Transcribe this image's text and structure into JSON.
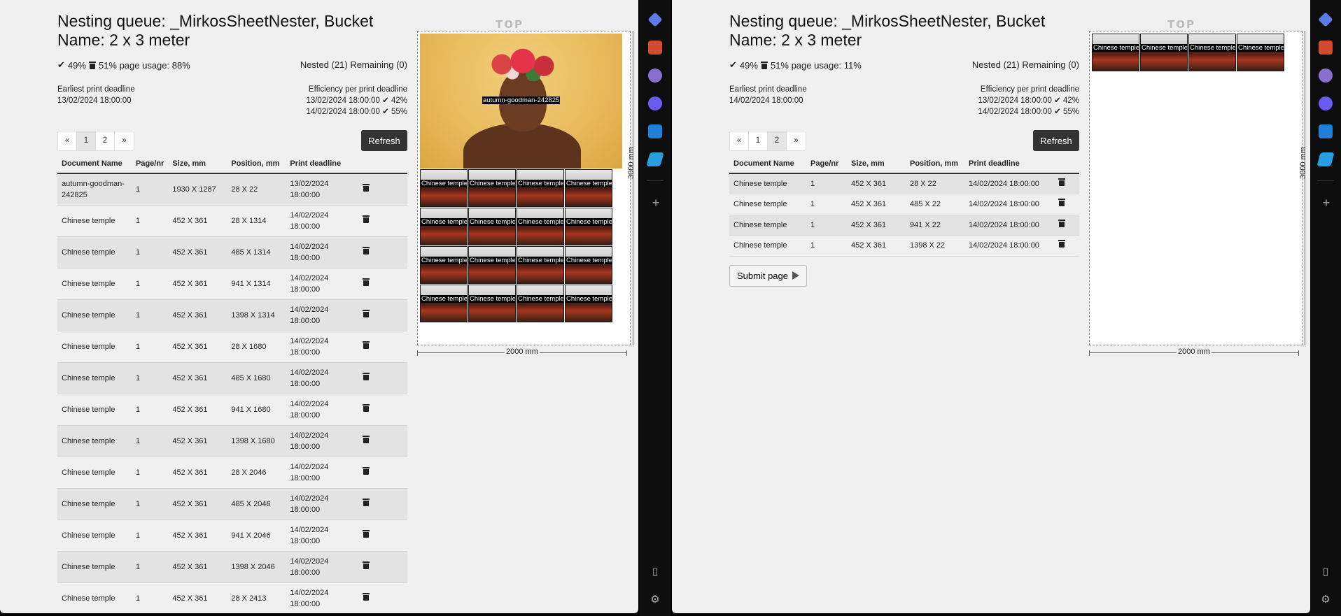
{
  "left_panel": {
    "title_line1": "Nesting queue: _MirkosSheetNester, Bucket",
    "title_line2": "Name: 2 x 3 meter",
    "usage": "49%  51% page usage: 88%",
    "usage_check": "49%",
    "usage_trash": "51% page usage: 88%",
    "nested": "Nested (21) Remaining (0)",
    "earliest_label": "Earliest print deadline",
    "earliest_value": "13/02/2024 18:00:00",
    "efficiency_label": "Efficiency per print deadline",
    "efficiency_1": "13/02/2024 18:00:00 ✔ 42%",
    "efficiency_2": "14/02/2024 18:00:00 ✔ 55%",
    "pager": [
      "«",
      "1",
      "2",
      "»"
    ],
    "active_page": 1,
    "refresh_label": "Refresh",
    "columns": [
      "Document Name",
      "Page/nr",
      "Size, mm",
      "Position, mm",
      "Print deadline"
    ],
    "rows": [
      {
        "name": "autumn-goodman-242825",
        "page": "1",
        "size": "1930 X 1287",
        "pos": "28 X 22",
        "deadline": "13/02/2024 18:00:00"
      },
      {
        "name": "Chinese temple",
        "page": "1",
        "size": "452 X 361",
        "pos": "28 X 1314",
        "deadline": "14/02/2024 18:00:00"
      },
      {
        "name": "Chinese temple",
        "page": "1",
        "size": "452 X 361",
        "pos": "485 X 1314",
        "deadline": "14/02/2024 18:00:00"
      },
      {
        "name": "Chinese temple",
        "page": "1",
        "size": "452 X 361",
        "pos": "941 X 1314",
        "deadline": "14/02/2024 18:00:00"
      },
      {
        "name": "Chinese temple",
        "page": "1",
        "size": "452 X 361",
        "pos": "1398 X 1314",
        "deadline": "14/02/2024 18:00:00"
      },
      {
        "name": "Chinese temple",
        "page": "1",
        "size": "452 X 361",
        "pos": "28 X 1680",
        "deadline": "14/02/2024 18:00:00"
      },
      {
        "name": "Chinese temple",
        "page": "1",
        "size": "452 X 361",
        "pos": "485 X 1680",
        "deadline": "14/02/2024 18:00:00"
      },
      {
        "name": "Chinese temple",
        "page": "1",
        "size": "452 X 361",
        "pos": "941 X 1680",
        "deadline": "14/02/2024 18:00:00"
      },
      {
        "name": "Chinese temple",
        "page": "1",
        "size": "452 X 361",
        "pos": "1398 X 1680",
        "deadline": "14/02/2024 18:00:00"
      },
      {
        "name": "Chinese temple",
        "page": "1",
        "size": "452 X 361",
        "pos": "28 X 2046",
        "deadline": "14/02/2024 18:00:00"
      },
      {
        "name": "Chinese temple",
        "page": "1",
        "size": "452 X 361",
        "pos": "485 X 2046",
        "deadline": "14/02/2024 18:00:00"
      },
      {
        "name": "Chinese temple",
        "page": "1",
        "size": "452 X 361",
        "pos": "941 X 2046",
        "deadline": "14/02/2024 18:00:00"
      },
      {
        "name": "Chinese temple",
        "page": "1",
        "size": "452 X 361",
        "pos": "1398 X 2046",
        "deadline": "14/02/2024 18:00:00"
      },
      {
        "name": "Chinese temple",
        "page": "1",
        "size": "452 X 361",
        "pos": "28 X 2413",
        "deadline": "14/02/2024 18:00:00"
      }
    ],
    "top_label": "TOP",
    "height_label": "3000 mm",
    "width_label": "2000 mm",
    "portrait_label": "autumn-goodman-242825",
    "tile_label": "Chinese temple"
  },
  "right_panel": {
    "title_line1": "Nesting queue: _MirkosSheetNester, Bucket",
    "title_line2": "Name: 2 x 3 meter",
    "usage_check": "49%",
    "usage_trash": "51% page usage: 11%",
    "nested": "Nested (21) Remaining (0)",
    "earliest_label": "Earliest print deadline",
    "earliest_value": "14/02/2024 18:00:00",
    "efficiency_label": "Efficiency per print deadline",
    "efficiency_1": "13/02/2024 18:00:00 ✔ 42%",
    "efficiency_2": "14/02/2024 18:00:00 ✔ 55%",
    "pager": [
      "«",
      "1",
      "2",
      "»"
    ],
    "active_page": 2,
    "refresh_label": "Refresh",
    "columns": [
      "Document Name",
      "Page/nr",
      "Size, mm",
      "Position, mm",
      "Print deadline"
    ],
    "rows": [
      {
        "name": "Chinese temple",
        "page": "1",
        "size": "452 X 361",
        "pos": "28 X 22",
        "deadline": "14/02/2024 18:00:00"
      },
      {
        "name": "Chinese temple",
        "page": "1",
        "size": "452 X 361",
        "pos": "485 X 22",
        "deadline": "14/02/2024 18:00:00"
      },
      {
        "name": "Chinese temple",
        "page": "1",
        "size": "452 X 361",
        "pos": "941 X 22",
        "deadline": "14/02/2024 18:00:00"
      },
      {
        "name": "Chinese temple",
        "page": "1",
        "size": "452 X 361",
        "pos": "1398 X 22",
        "deadline": "14/02/2024 18:00:00"
      }
    ],
    "submit_label": "Submit page",
    "top_label": "TOP",
    "height_label": "3000 mm",
    "width_label": "2000 mm",
    "tile_label": "Chinese temple"
  },
  "sidebar_icons": [
    "tag-icon",
    "toolbox-icon",
    "people-icon",
    "copilot-icon",
    "outlook-icon",
    "send-icon",
    "add-icon",
    "sidebar-toggle-icon",
    "settings-icon"
  ],
  "sidebar_colors": {
    "tag": "#5b7be8",
    "toolbox": "#d24b2f",
    "people": "#8a6fd1",
    "copilot": "#6a5cf0",
    "outlook": "#1f7fd9",
    "send": "#2a9de0"
  }
}
